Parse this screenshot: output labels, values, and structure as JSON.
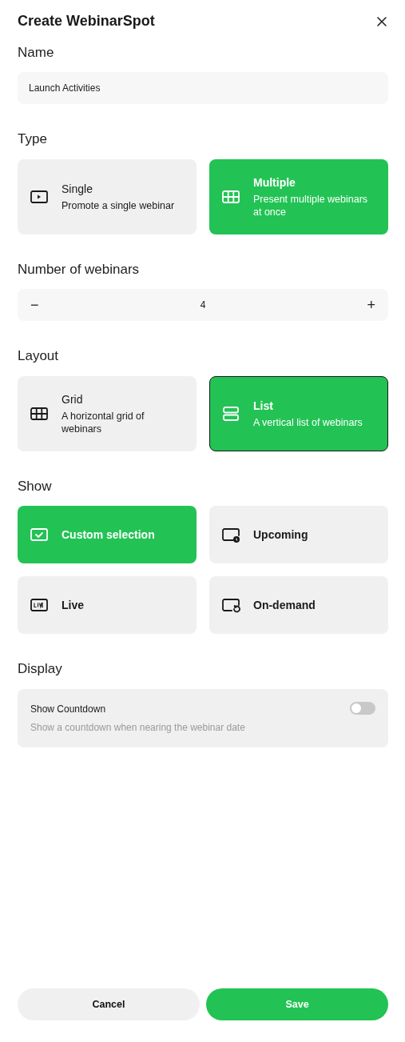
{
  "title": "Create WebinarSpot",
  "name_section": {
    "label": "Name",
    "value": "Launch Activities"
  },
  "type_section": {
    "label": "Type",
    "options": [
      {
        "title": "Single",
        "description": "Promote a single webinar",
        "selected": false
      },
      {
        "title": "Multiple",
        "description": "Present multiple webinars at once",
        "selected": true
      }
    ]
  },
  "count_section": {
    "label": "Number of webinars",
    "minus": "−",
    "value": "4",
    "plus": "+"
  },
  "layout_section": {
    "label": "Layout",
    "options": [
      {
        "title": "Grid",
        "description": "A horizontal grid of webinars",
        "selected": false
      },
      {
        "title": "List",
        "description": "A vertical list of webinars",
        "selected": true
      }
    ]
  },
  "show_section": {
    "label": "Show",
    "options": [
      {
        "title": "Custom selection",
        "selected": true
      },
      {
        "title": "Upcoming",
        "selected": false
      },
      {
        "title": "Live",
        "selected": false
      },
      {
        "title": "On-demand",
        "selected": false
      }
    ]
  },
  "display_section": {
    "label": "Display",
    "toggles": [
      {
        "title": "Show Countdown",
        "description": "Show a countdown when nearing the webinar date",
        "on": false
      }
    ]
  },
  "buttons": [
    {
      "label": "Cancel",
      "kind": "secondary"
    },
    {
      "label": "Save",
      "kind": "primary"
    }
  ]
}
